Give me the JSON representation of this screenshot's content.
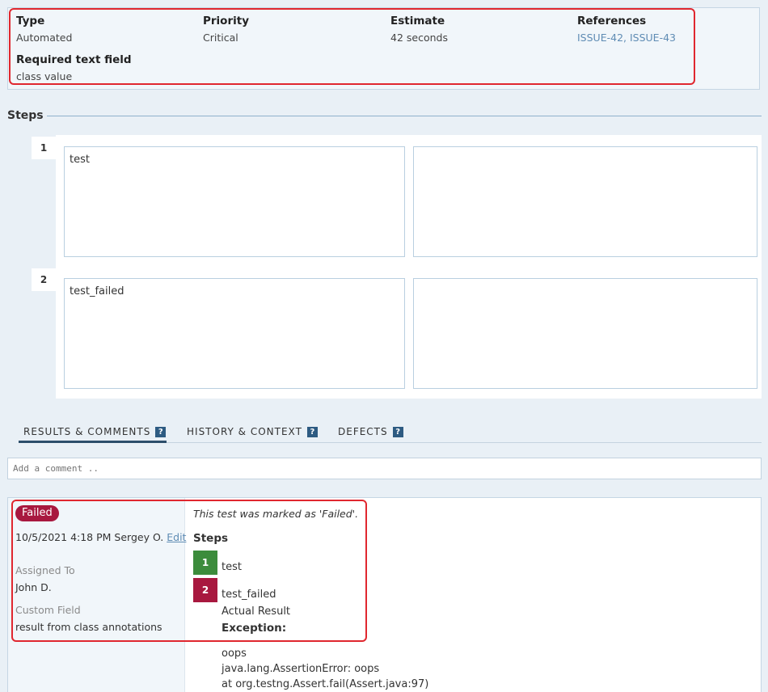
{
  "fields": [
    {
      "label": "Type",
      "value": "Automated"
    },
    {
      "label": "Priority",
      "value": "Critical"
    },
    {
      "label": "Estimate",
      "value": "42 seconds"
    },
    {
      "label": "References",
      "value": "ISSUE-42, ISSUE-43"
    }
  ],
  "required_field": {
    "label": "Required text field",
    "value": "class value"
  },
  "steps_title": "Steps",
  "steps": [
    {
      "number": "1",
      "content": "test",
      "expected": ""
    },
    {
      "number": "2",
      "content": "test_failed",
      "expected": ""
    }
  ],
  "tabs": [
    {
      "label": "RESULTS & COMMENTS",
      "help": "?"
    },
    {
      "label": "HISTORY & CONTEXT",
      "help": "?"
    },
    {
      "label": "DEFECTS",
      "help": "?"
    }
  ],
  "comment_placeholder": "Add a comment ..",
  "result": {
    "status": "Failed",
    "status_color": "#a8183f",
    "date_user": "10/5/2021 4:18 PM Sergey O.",
    "edit_label": "Edit",
    "assigned_label": "Assigned To",
    "assigned_value": "John D.",
    "custom_label": "Custom Field",
    "custom_value": "result from class annotations",
    "message": "This test was marked as 'Failed'.",
    "steps_heading": "Steps",
    "steps": [
      {
        "number": "1",
        "text": "test",
        "color": "#3c8c3c"
      },
      {
        "number": "2",
        "text": "test_failed",
        "color": "#a8183f"
      }
    ],
    "actual_result": "Actual Result",
    "exception_label": "Exception:",
    "exception_lines": [
      "oops",
      "java.lang.AssertionError: oops",
      "at org.testng.Assert.fail(Assert.java:97)"
    ]
  }
}
